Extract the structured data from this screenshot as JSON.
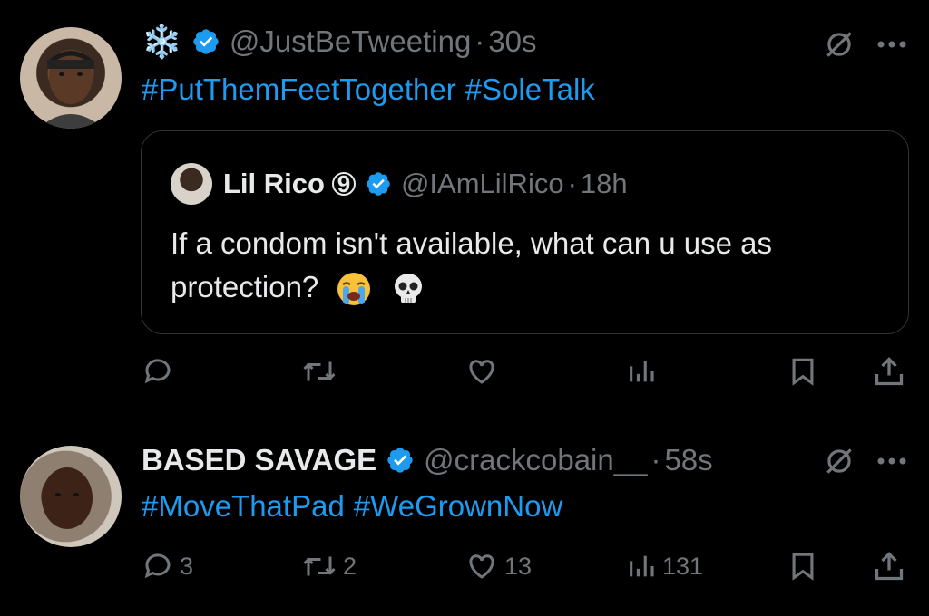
{
  "tweets": [
    {
      "display_name": "❄️",
      "handle": "@JustBeTweeting",
      "separator": "·",
      "time": "30s",
      "hashtags": [
        "#PutThemFeetTogether",
        "#SoleTalk"
      ],
      "quote": {
        "display_name": "Lil Rico",
        "badge": "9",
        "handle": "@IAmLilRico",
        "separator": "·",
        "time": "18h",
        "text": "If a condom isn't available, what can u use as protection?"
      },
      "actions": {
        "replies": "",
        "retweets": "",
        "likes": "",
        "views": ""
      }
    },
    {
      "display_name": "BASED SAVAGE",
      "handle": "@crackcobain__",
      "separator": "·",
      "time": "58s",
      "hashtags": [
        "#MoveThatPad",
        "#WeGrownNow"
      ],
      "actions": {
        "replies": "3",
        "retweets": "2",
        "likes": "13",
        "views": "131"
      }
    }
  ],
  "colors": {
    "accent": "#1d9bf0",
    "muted": "#71767b",
    "text": "#e7e9ea",
    "background": "#000000",
    "border": "#2f3336"
  },
  "icons": [
    "verified-icon",
    "grok-icon",
    "more-icon",
    "reply-icon",
    "retweet-icon",
    "like-icon",
    "views-icon",
    "bookmark-icon",
    "share-icon",
    "loudly-crying-emoji",
    "skull-emoji"
  ]
}
